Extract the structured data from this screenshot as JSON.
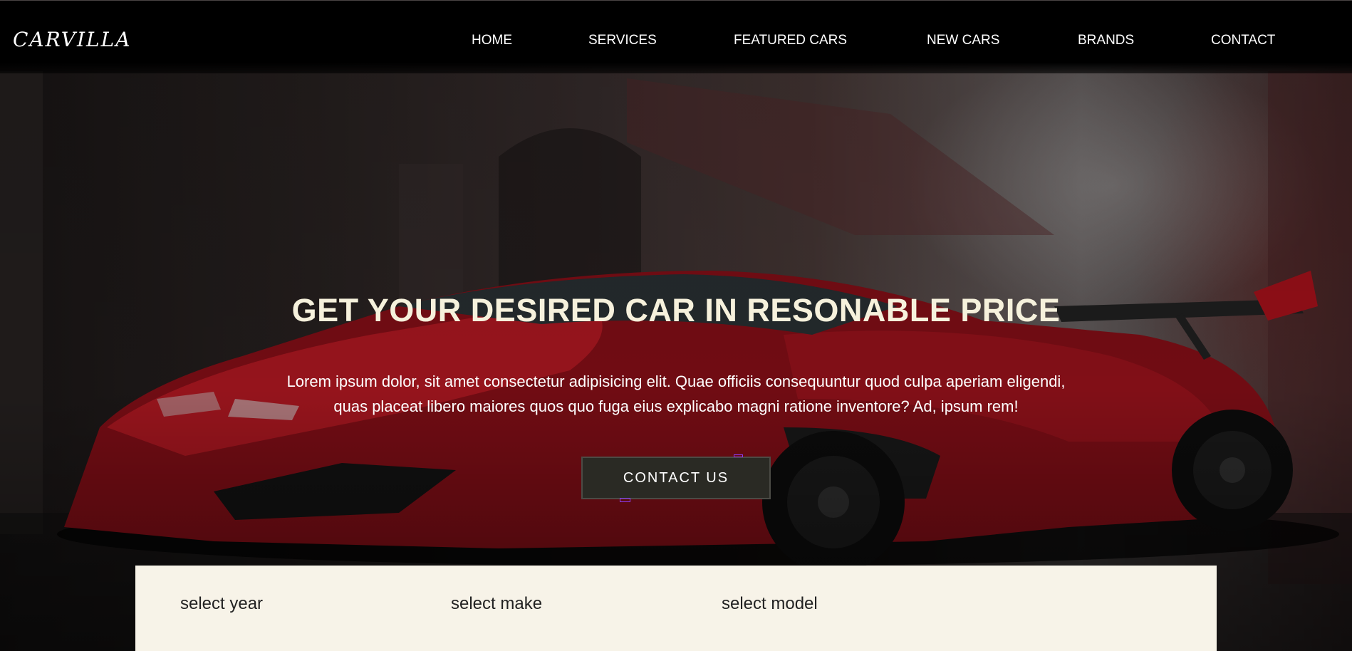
{
  "brand": {
    "logo_text": "CARVILLA"
  },
  "nav": {
    "items": [
      {
        "label": "HOME"
      },
      {
        "label": "SERVICES"
      },
      {
        "label": "FEATURED CARS"
      },
      {
        "label": "NEW CARS"
      },
      {
        "label": "BRANDS"
      },
      {
        "label": "CONTACT"
      }
    ]
  },
  "hero": {
    "title": "GET YOUR DESIRED CAR IN RESONABLE PRICE",
    "description": "Lorem ipsum dolor, sit amet consectetur adipisicing elit. Quae officiis consequuntur quod culpa aperiam eligendi, quas placeat libero maiores quos quo fuga eius explicabo magni ratione inventore? Ad, ipsum rem!",
    "cta_label": "CONTACT US"
  },
  "search": {
    "year_label": "select year",
    "make_label": "select make",
    "model_label": "select model"
  },
  "colors": {
    "title": "#f6f1dc",
    "panel_bg": "#f7f3e8",
    "car_red": "#b0121c",
    "nav_bg": "#000000"
  }
}
